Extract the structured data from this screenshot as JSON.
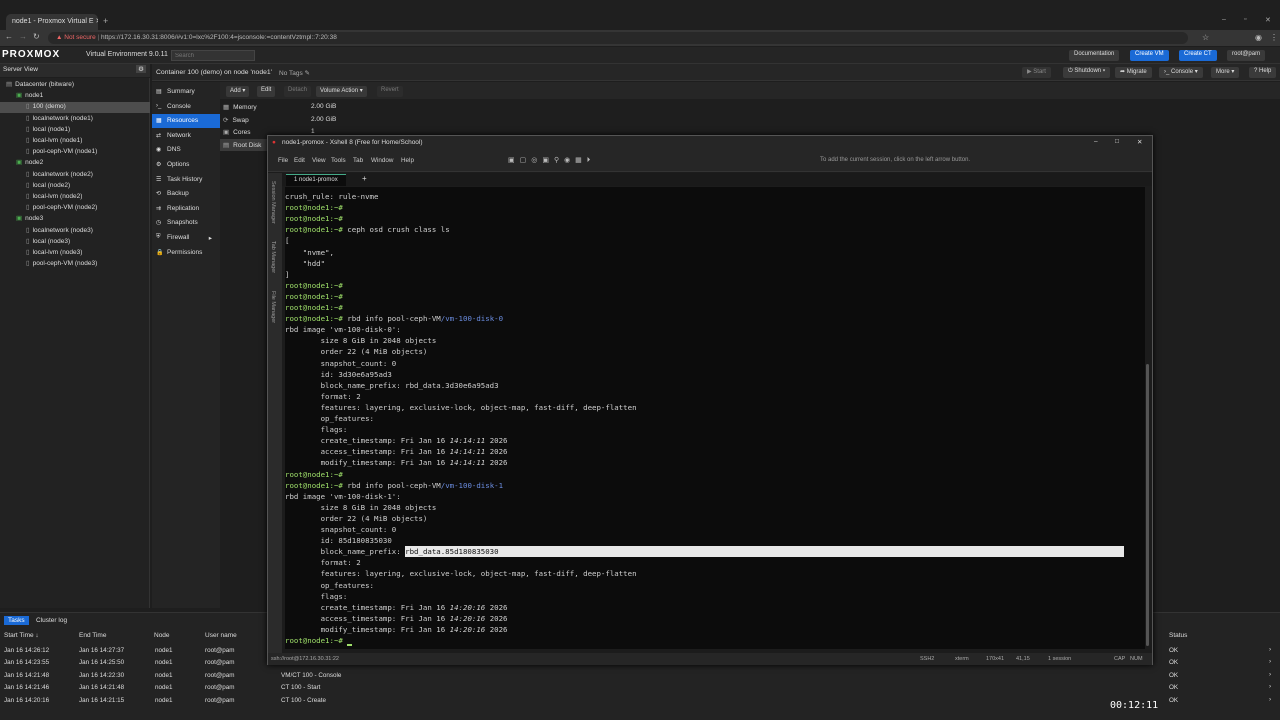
{
  "browser": {
    "tab_title": "node1 - Proxmox Virtual E",
    "not_secure": "Not secure",
    "url": "https://172.16.30.31:8006/#v1:0=lxc%2F100:4=jsconsole:=contentVztmpl::7:20:38"
  },
  "pve": {
    "logo": "PROXMOX",
    "version": "Virtual Environment 9.0.11",
    "search_placeholder": "Search",
    "buttons": {
      "documentation": "Documentation",
      "create_vm": "Create VM",
      "create_ct": "Create CT",
      "user": "root@pam",
      "help": "Help"
    },
    "server_view": "Server View",
    "tree": [
      {
        "label": "Datacenter (bitware)",
        "indent": 0
      },
      {
        "label": "node1",
        "indent": 1
      },
      {
        "label": "100 (demo)",
        "indent": 2,
        "selected": true
      },
      {
        "label": "localnetwork (node1)",
        "indent": 2
      },
      {
        "label": "local (node1)",
        "indent": 2
      },
      {
        "label": "local-lvm (node1)",
        "indent": 2
      },
      {
        "label": "pool-ceph-VM (node1)",
        "indent": 2
      },
      {
        "label": "node2",
        "indent": 1
      },
      {
        "label": "localnetwork (node2)",
        "indent": 2
      },
      {
        "label": "local (node2)",
        "indent": 2
      },
      {
        "label": "local-lvm (node2)",
        "indent": 2
      },
      {
        "label": "pool-ceph-VM (node2)",
        "indent": 2
      },
      {
        "label": "node3",
        "indent": 1
      },
      {
        "label": "localnetwork (node3)",
        "indent": 2
      },
      {
        "label": "local (node3)",
        "indent": 2
      },
      {
        "label": "local-lvm (node3)",
        "indent": 2
      },
      {
        "label": "pool-ceph-VM (node3)",
        "indent": 2
      }
    ],
    "container_title": "Container 100 (demo) on node 'node1'",
    "no_tags": "No Tags",
    "actions": {
      "start": "Start",
      "shutdown": "Shutdown",
      "migrate": "Migrate",
      "console": "Console",
      "more": "More",
      "help": "Help"
    },
    "nav": [
      "Summary",
      "Console",
      "Resources",
      "Network",
      "DNS",
      "Options",
      "Task History",
      "Backup",
      "Replication",
      "Snapshots",
      "Firewall",
      "Permissions"
    ],
    "nav_selected": 2,
    "toolbar": [
      "Add",
      "Edit",
      "Detach",
      "Volume Action",
      "Revert"
    ],
    "resources": [
      {
        "name": "Memory",
        "value": "2.00 GiB"
      },
      {
        "name": "Swap",
        "value": "2.00 GiB"
      },
      {
        "name": "Cores",
        "value": "1"
      },
      {
        "name": "Root Disk",
        "value": ""
      }
    ],
    "log_tabs": [
      "Tasks",
      "Cluster log"
    ],
    "log_headers": {
      "start": "Start Time",
      "end": "End Time",
      "node": "Node",
      "user": "User name",
      "status": "Status"
    },
    "log_rows": [
      {
        "start": "Jan 16 14:26:12",
        "end": "Jan 16 14:27:37",
        "node": "node1",
        "user": "root@pam",
        "desc": "",
        "status": "OK"
      },
      {
        "start": "Jan 16 14:23:55",
        "end": "Jan 16 14:25:50",
        "node": "node1",
        "user": "root@pam",
        "desc": "",
        "status": "OK"
      },
      {
        "start": "Jan 16 14:21:48",
        "end": "Jan 16 14:22:30",
        "node": "node1",
        "user": "root@pam",
        "desc": "VM/CT 100 - Console",
        "status": "OK"
      },
      {
        "start": "Jan 16 14:21:46",
        "end": "Jan 16 14:21:48",
        "node": "node1",
        "user": "root@pam",
        "desc": "CT 100 - Start",
        "status": "OK"
      },
      {
        "start": "Jan 16 14:20:16",
        "end": "Jan 16 14:21:15",
        "node": "node1",
        "user": "root@pam",
        "desc": "CT 100 - Create",
        "status": "OK"
      }
    ]
  },
  "xshell": {
    "title": "node1-promox - Xshell 8 (Free for Home/School)",
    "menu": [
      "File",
      "Edit",
      "View",
      "Tools",
      "Tab",
      "Window",
      "Help"
    ],
    "hint": "To add the current session, click on the left arrow button.",
    "tab": "1 node1-promox",
    "side": [
      "Session Manager",
      "Tab Manager",
      "File Manager"
    ],
    "status": {
      "conn": "ssh://root@172.16.30.31:22",
      "proto": "SSH2",
      "term": "xterm",
      "size": "170x41",
      "pos": "41,15",
      "sessions": "1 session",
      "caps": "CAP",
      "num": "NUM"
    }
  },
  "video": {
    "time": "00:12:11"
  },
  "terminal": [
    {
      "t": "crush_rule: rule-nvme"
    },
    {
      "p": "root@node1:~#",
      "t": ""
    },
    {
      "p": "root@node1:~#",
      "t": ""
    },
    {
      "p": "root@node1:~#",
      "t": " ceph osd crush class ls"
    },
    {
      "t": "["
    },
    {
      "t": "    \"nvme\","
    },
    {
      "t": "    \"hdd\""
    },
    {
      "t": "]"
    },
    {
      "p": "root@node1:~#",
      "t": ""
    },
    {
      "p": "root@node1:~#",
      "t": ""
    },
    {
      "p": "root@node1:~#",
      "t": ""
    },
    {
      "p": "root@node1:~#",
      "t": " rbd info pool-ceph-VM",
      "path": "/vm-100-disk-0"
    },
    {
      "t": "rbd image 'vm-100-disk-0':"
    },
    {
      "t": "        size 8 GiB in 2048 objects"
    },
    {
      "t": "        order 22 (4 MiB objects)"
    },
    {
      "t": "        snapshot_count: 0"
    },
    {
      "t": "        id: 3d30e6a95ad3"
    },
    {
      "t": "        block_name_prefix: rbd_data.3d30e6a95ad3"
    },
    {
      "t": "        format: 2"
    },
    {
      "t": "        features: layering, exclusive-lock, object-map, fast-diff, deep-flatten"
    },
    {
      "t": "        op_features:"
    },
    {
      "t": "        flags:"
    },
    {
      "t": "        create_timestamp: Fri Jan 16 ",
      "it": "14:14:11",
      "t2": " 2026"
    },
    {
      "t": "        access_timestamp: Fri Jan 16 ",
      "it": "14:14:11",
      "t2": " 2026"
    },
    {
      "t": "        modify_timestamp: Fri Jan 16 ",
      "it": "14:14:11",
      "t2": " 2026"
    },
    {
      "p": "root@node1:~#",
      "t": ""
    },
    {
      "p": "root@node1:~#",
      "t": " rbd info pool-ceph-VM",
      "path": "/vm-100-disk-1"
    },
    {
      "t": "rbd image 'vm-100-disk-1':"
    },
    {
      "t": "        size 8 GiB in 2048 objects"
    },
    {
      "t": "        order 22 (4 MiB objects)"
    },
    {
      "t": "        snapshot_count: 0"
    },
    {
      "t": "        id: 85d180835030"
    },
    {
      "t": "        block_name_prefix: ",
      "hl": "rbd_data.85d180835030"
    },
    {
      "t": "        format: 2"
    },
    {
      "t": "        features: layering, exclusive-lock, object-map, fast-diff, deep-flatten"
    },
    {
      "t": "        op_features:"
    },
    {
      "t": "        flags:"
    },
    {
      "t": "        create_timestamp: Fri Jan 16 ",
      "it": "14:20:16",
      "t2": " 2026"
    },
    {
      "t": "        access_timestamp: Fri Jan 16 ",
      "it": "14:20:16",
      "t2": " 2026"
    },
    {
      "t": "        modify_timestamp: Fri Jan 16 ",
      "it": "14:20:16",
      "t2": " 2026"
    },
    {
      "p": "root@node1:~#",
      "t": " ",
      "cursor": true
    }
  ]
}
